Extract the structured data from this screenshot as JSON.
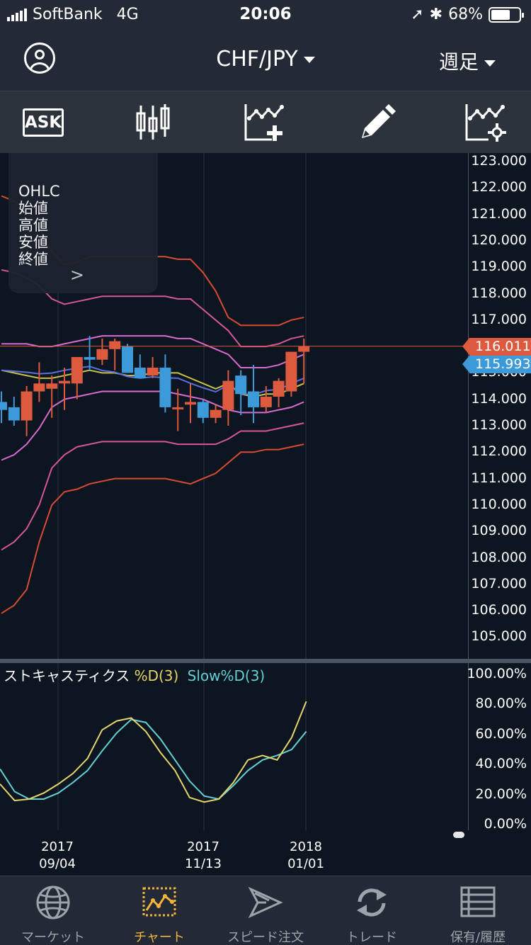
{
  "status_bar": {
    "carrier": "SoftBank",
    "network": "4G",
    "time": "20:06",
    "battery": "68%"
  },
  "header": {
    "pair": "CHF/JPY",
    "period": "週足"
  },
  "toolbar": {
    "ask_label": "ASK"
  },
  "ohlc_panel": {
    "title": "OHLC",
    "open": "始値",
    "high": "高値",
    "low": "安値",
    "close": "終値"
  },
  "price_axis": {
    "ticks": [
      "123.000",
      "122.000",
      "121.000",
      "120.000",
      "119.000",
      "118.000",
      "117.000",
      "116.000",
      "115.000",
      "114.000",
      "113.000",
      "112.000",
      "111.000",
      "110.000",
      "109.000",
      "108.000",
      "107.000",
      "106.000",
      "105.000"
    ]
  },
  "price_tags": {
    "ask": "116.011",
    "bid": "115.993"
  },
  "oscillator": {
    "name": "ストキャスティクス",
    "d_label": "%D(3)",
    "slow_label": "Slow%D(3)",
    "ticks": [
      "100.00%",
      "80.00%",
      "60.00%",
      "40.00%",
      "20.00%",
      "0.00%"
    ],
    "colors": {
      "d": "#e6d56a",
      "slow": "#63d0d6"
    }
  },
  "x_axis": {
    "labels": [
      {
        "year": "2017",
        "date": "09/04"
      },
      {
        "year": "2017",
        "date": "11/13"
      },
      {
        "year": "2018",
        "date": "01/01"
      }
    ]
  },
  "tabs": [
    {
      "label": "マーケット"
    },
    {
      "label": "チャート"
    },
    {
      "label": "スピード注文"
    },
    {
      "label": "トレード"
    },
    {
      "label": "保有/履歴"
    }
  ],
  "colors": {
    "up": "#dc5a3e",
    "down": "#3c9ad9",
    "accent": "#f3b43a"
  },
  "chart_data": {
    "type": "candlestick",
    "interval": "weekly",
    "x_labels": [
      "2017/09/04",
      "2017/11/13",
      "2018/01/01"
    ],
    "ylim": [
      104.5,
      123.4
    ],
    "y_unit": "JPY",
    "candles": [
      {
        "o": 113.9,
        "h": 114.3,
        "l": 113.1,
        "c": 113.6
      },
      {
        "o": 113.7,
        "h": 114.1,
        "l": 113.0,
        "c": 113.2
      },
      {
        "o": 113.2,
        "h": 114.5,
        "l": 112.6,
        "c": 114.3
      },
      {
        "o": 114.3,
        "h": 115.4,
        "l": 113.9,
        "c": 114.6
      },
      {
        "o": 114.4,
        "h": 114.9,
        "l": 113.3,
        "c": 114.6
      },
      {
        "o": 114.6,
        "h": 115.2,
        "l": 113.6,
        "c": 114.7
      },
      {
        "o": 114.6,
        "h": 115.3,
        "l": 114.0,
        "c": 115.6
      },
      {
        "o": 115.6,
        "h": 116.4,
        "l": 115.1,
        "c": 115.5
      },
      {
        "o": 115.5,
        "h": 116.3,
        "l": 115.3,
        "c": 115.9
      },
      {
        "o": 115.9,
        "h": 116.3,
        "l": 115.1,
        "c": 116.2
      },
      {
        "o": 116.0,
        "h": 116.1,
        "l": 115.0,
        "c": 115.0
      },
      {
        "o": 115.2,
        "h": 115.7,
        "l": 114.8,
        "c": 114.8
      },
      {
        "o": 114.9,
        "h": 115.6,
        "l": 114.8,
        "c": 115.2
      },
      {
        "o": 115.2,
        "h": 115.7,
        "l": 113.5,
        "c": 113.7
      },
      {
        "o": 113.7,
        "h": 114.4,
        "l": 112.8,
        "c": 113.7
      },
      {
        "o": 113.8,
        "h": 114.6,
        "l": 113.1,
        "c": 113.9
      },
      {
        "o": 113.9,
        "h": 114.0,
        "l": 113.1,
        "c": 113.3
      },
      {
        "o": 113.3,
        "h": 113.8,
        "l": 113.1,
        "c": 113.6
      },
      {
        "o": 113.6,
        "h": 115.1,
        "l": 113.0,
        "c": 114.7
      },
      {
        "o": 114.9,
        "h": 115.1,
        "l": 113.4,
        "c": 114.2
      },
      {
        "o": 114.3,
        "h": 115.3,
        "l": 113.1,
        "c": 113.7
      },
      {
        "o": 113.7,
        "h": 114.5,
        "l": 113.5,
        "c": 114.1
      },
      {
        "o": 114.1,
        "h": 114.8,
        "l": 113.7,
        "c": 114.7
      },
      {
        "o": 114.3,
        "h": 115.8,
        "l": 114.1,
        "c": 115.8
      },
      {
        "o": 115.8,
        "h": 116.3,
        "l": 114.6,
        "c": 116.0
      }
    ],
    "bands": {
      "upper3": [
        121.7,
        121.5,
        121.1,
        120.5,
        119.6,
        119.1,
        119.2,
        119.4,
        119.4,
        119.4,
        119.4,
        119.4,
        119.4,
        119.4,
        119.3,
        119.3,
        118.8,
        118.1,
        117.1,
        116.8,
        116.8,
        116.8,
        116.8,
        117.0,
        117.1
      ],
      "upper2": [
        118.9,
        118.8,
        118.6,
        118.3,
        117.8,
        117.6,
        117.7,
        117.8,
        117.9,
        117.9,
        117.9,
        117.9,
        117.9,
        117.9,
        117.8,
        117.8,
        117.4,
        117.0,
        116.6,
        116.0,
        116.0,
        116.0,
        116.1,
        116.3,
        116.4
      ],
      "upper1": [
        116.1,
        116.1,
        116.1,
        116.0,
        116.0,
        116.1,
        116.2,
        116.3,
        116.4,
        116.4,
        116.4,
        116.4,
        116.4,
        116.4,
        116.3,
        116.3,
        116.1,
        115.9,
        115.7,
        115.2,
        115.2,
        115.2,
        115.3,
        115.5,
        115.7
      ],
      "mid": [
        115.1,
        115.0,
        114.9,
        114.8,
        114.8,
        114.9,
        115.0,
        115.1,
        115.0,
        115.0,
        114.9,
        114.9,
        115.0,
        115.0,
        115.0,
        114.8,
        114.6,
        114.4,
        114.6,
        114.2,
        114.1,
        114.2,
        114.2,
        114.4,
        114.6
      ],
      "lower1": [
        111.7,
        111.9,
        112.3,
        112.9,
        113.7,
        114.0,
        114.1,
        114.2,
        114.3,
        114.3,
        114.3,
        114.3,
        114.3,
        114.3,
        114.2,
        114.1,
        114.0,
        113.8,
        113.6,
        113.5,
        113.5,
        113.5,
        113.6,
        113.7,
        113.9
      ],
      "lower2": [
        108.3,
        108.6,
        109.1,
        110.0,
        111.4,
        111.9,
        112.2,
        112.3,
        112.4,
        112.4,
        112.4,
        112.4,
        112.4,
        112.4,
        112.3,
        112.3,
        112.3,
        112.3,
        112.5,
        112.8,
        112.8,
        112.8,
        112.9,
        113.0,
        113.1
      ],
      "lower3": [
        105.9,
        106.2,
        106.8,
        108.6,
        110.0,
        110.5,
        110.6,
        110.8,
        110.9,
        111.0,
        111.0,
        111.0,
        111.0,
        111.0,
        110.9,
        110.8,
        111.0,
        111.2,
        111.6,
        112.0,
        112.0,
        112.1,
        112.1,
        112.2,
        112.3
      ]
    },
    "current_price": 116.011,
    "oscillator_ylim": [
      0,
      100
    ],
    "stochastic_d": [
      27,
      16,
      17,
      21,
      27,
      34,
      44,
      63,
      69,
      71,
      62,
      48,
      36,
      18,
      15,
      17,
      28,
      43,
      46,
      43,
      58,
      82
    ],
    "stochastic_slow_d": [
      37,
      22,
      17,
      17,
      21,
      28,
      36,
      49,
      61,
      70,
      68,
      57,
      43,
      29,
      19,
      17,
      26,
      36,
      43,
      46,
      50,
      62
    ]
  }
}
